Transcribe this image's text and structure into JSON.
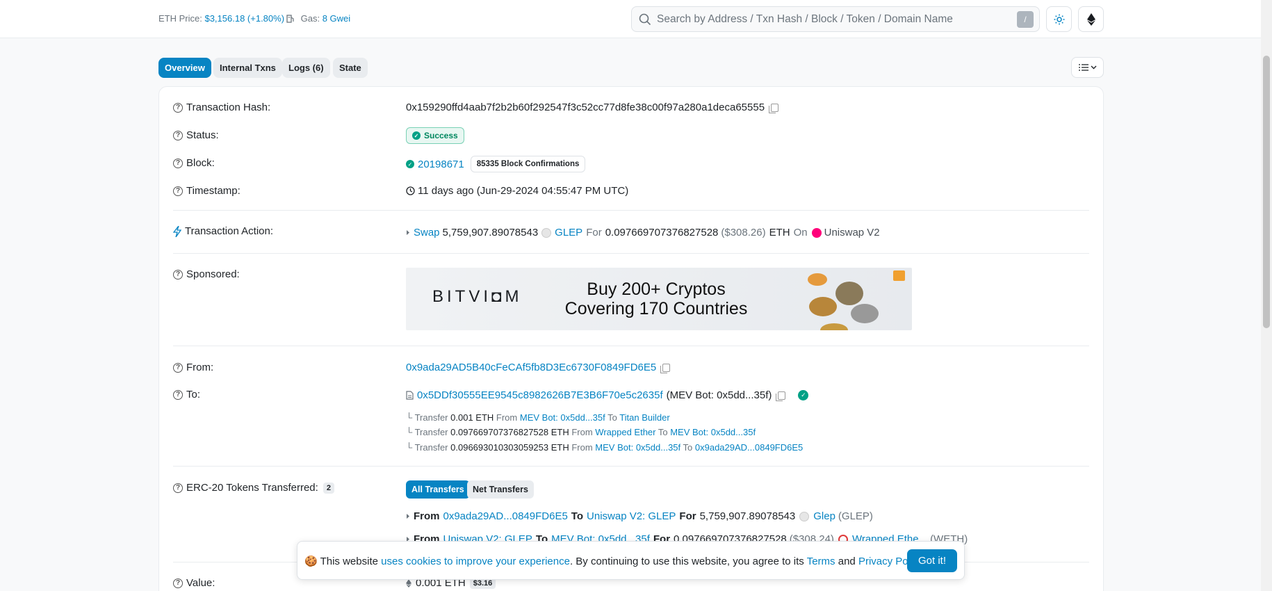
{
  "header": {
    "eth_price_label": "ETH Price:",
    "eth_price_value": "$3,156.18 (+1.80%)",
    "gas_label": "Gas:",
    "gas_value": "8 Gwei",
    "search_placeholder": "Search by Address / Txn Hash / Block / Token / Domain Name",
    "search_shortcut": "/"
  },
  "tabs": [
    "Overview",
    "Internal Txns",
    "Logs (6)",
    "State"
  ],
  "tx": {
    "hash_label": "Transaction Hash:",
    "hash": "0x159290ffd4aab7f2b2b60f292547f3c52cc77d8fe38c00f97a280a1deca65555",
    "status_label": "Status:",
    "status": "Success",
    "block_label": "Block:",
    "block": "20198671",
    "confirmations": "85335 Block Confirmations",
    "timestamp_label": "Timestamp:",
    "timestamp": "11 days ago (Jun-29-2024 04:55:47 PM UTC)",
    "action_label": "Transaction Action:",
    "action": {
      "verb": "Swap",
      "amount_in": "5,759,907.89078543",
      "token_in": "GLEP",
      "for_word": "For",
      "amount_out": "0.097669707376827528",
      "amount_out_usd": "($308.26)",
      "token_out": "ETH",
      "on_word": "On",
      "dex": "Uniswap V2"
    },
    "sponsored_label": "Sponsored:",
    "ad": {
      "brand": "BITVI◘M",
      "line1": "Buy 200+ Cryptos",
      "line2": "Covering 170 Countries"
    },
    "from_label": "From:",
    "from": "0x9ada29AD5B40cFeCAf5fb8D3Ec6730F0849FD6E5",
    "to_label": "To:",
    "to": "0x5DDf30555EE9545c8982626B7E3B6F70e5c2635f",
    "to_name": "(MEV Bot: 0x5dd...35f)",
    "transfers": [
      {
        "word": "Transfer",
        "amount": "0.001 ETH",
        "from": "MEV Bot: 0x5dd...35f",
        "to": "Titan Builder"
      },
      {
        "word": "Transfer",
        "amount": "0.097669707376827528 ETH",
        "from": "Wrapped Ether",
        "to": "MEV Bot: 0x5dd...35f"
      },
      {
        "word": "Transfer",
        "amount": "0.096693010303059253 ETH",
        "from": "MEV Bot: 0x5dd...35f",
        "to": "0x9ada29AD...0849FD6E5"
      }
    ],
    "erc20_label": "ERC-20 Tokens Transferred:",
    "erc20_count": "2",
    "erc20_tabs": [
      "All Transfers",
      "Net Transfers"
    ],
    "erc20_rows": [
      {
        "from": "0x9ada29AD...0849FD6E5",
        "to": "Uniswap V2: GLEP",
        "amount": "5,759,907.89078543",
        "token": "Glep",
        "symbol": "(GLEP)"
      },
      {
        "from": "Uniswap V2: GLEP",
        "to": "MEV Bot: 0x5dd...35f",
        "amount": "0.097669707376827528",
        "usd": "($308.24)",
        "token": "Wrapped Ethe...",
        "symbol": "(WETH)"
      }
    ],
    "value_label": "Value:",
    "value": "0.001 ETH",
    "value_usd": "$3.16"
  },
  "cookie": {
    "text1": "This website",
    "link1": "uses cookies to improve your experience",
    "text2": ". By continuing to use this website, you agree to its",
    "link2": "Terms",
    "text3": "and",
    "link3": "Privacy Policy",
    "text4": ".",
    "button": "Got it!"
  },
  "colors": {
    "link": "#0784c3",
    "success": "#00a186",
    "accent": "#0784c3"
  }
}
